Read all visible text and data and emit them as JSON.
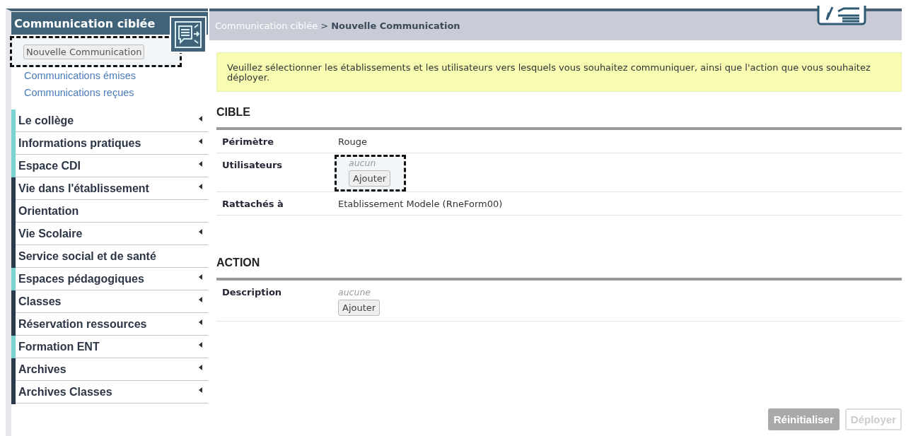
{
  "sidebar": {
    "title": "Communication ciblée",
    "actions": [
      {
        "label": "Nouvelle Communication",
        "kind": "button",
        "highlighted": true
      },
      {
        "label": "Communications émises",
        "kind": "link",
        "highlighted": false
      },
      {
        "label": "Communications reçues",
        "kind": "link",
        "highlighted": false
      }
    ],
    "items": [
      {
        "label": "Le collège",
        "color": "#7dd3d0",
        "expandable": true
      },
      {
        "label": "Informations pratiques",
        "color": "#7dd3d0",
        "expandable": true
      },
      {
        "label": "Espace CDI",
        "color": "#7dd3d0",
        "expandable": true
      },
      {
        "label": "Vie dans l'établissement",
        "color": "#2c3b4c",
        "expandable": true
      },
      {
        "label": "Orientation",
        "color": "#2c3b4c",
        "expandable": false
      },
      {
        "label": "Vie Scolaire",
        "color": "#2c3b4c",
        "expandable": true
      },
      {
        "label": "Service social et de santé",
        "color": "#2c3b4c",
        "expandable": false
      },
      {
        "label": "Espaces pédagogiques",
        "color": "#7dd3d0",
        "expandable": true
      },
      {
        "label": "Classes",
        "color": "#2c3b4c",
        "expandable": true
      },
      {
        "label": "Réservation ressources",
        "color": "#2c3b4c",
        "expandable": true
      },
      {
        "label": "Formation ENT",
        "color": "#7dd3d0",
        "expandable": true
      },
      {
        "label": "Archives",
        "color": "#2c3b4c",
        "expandable": true
      },
      {
        "label": "Archives Classes",
        "color": "#2c3b4c",
        "expandable": true
      }
    ]
  },
  "breadcrumb": {
    "parent": "Communication ciblée",
    "separator": ">",
    "current": "Nouvelle Communication"
  },
  "notice": "Veuillez sélectionner les établissements et les utilisateurs vers lesquels vous souhaitez communiquer, ainsi que l'action que vous souhaitez déployer.",
  "sections": [
    {
      "title": "CIBLE",
      "rows": [
        {
          "label": "Périmètre",
          "kind": "text",
          "value": "Rouge",
          "highlighted": false
        },
        {
          "label": "Utilisateurs",
          "kind": "add",
          "empty": "aucun",
          "button": "Ajouter",
          "highlighted": true
        },
        {
          "label": "Rattachés à",
          "kind": "text",
          "value": "Etablissement Modele (RneForm00)",
          "highlighted": false
        }
      ]
    },
    {
      "title": "ACTION",
      "rows": [
        {
          "label": "Description",
          "kind": "add",
          "empty": "aucune",
          "button": "Ajouter",
          "highlighted": false
        }
      ]
    }
  ],
  "buttons": [
    {
      "label": "Réinitialiser",
      "kind": "filled"
    },
    {
      "label": "Déployer",
      "kind": "outline"
    }
  ]
}
